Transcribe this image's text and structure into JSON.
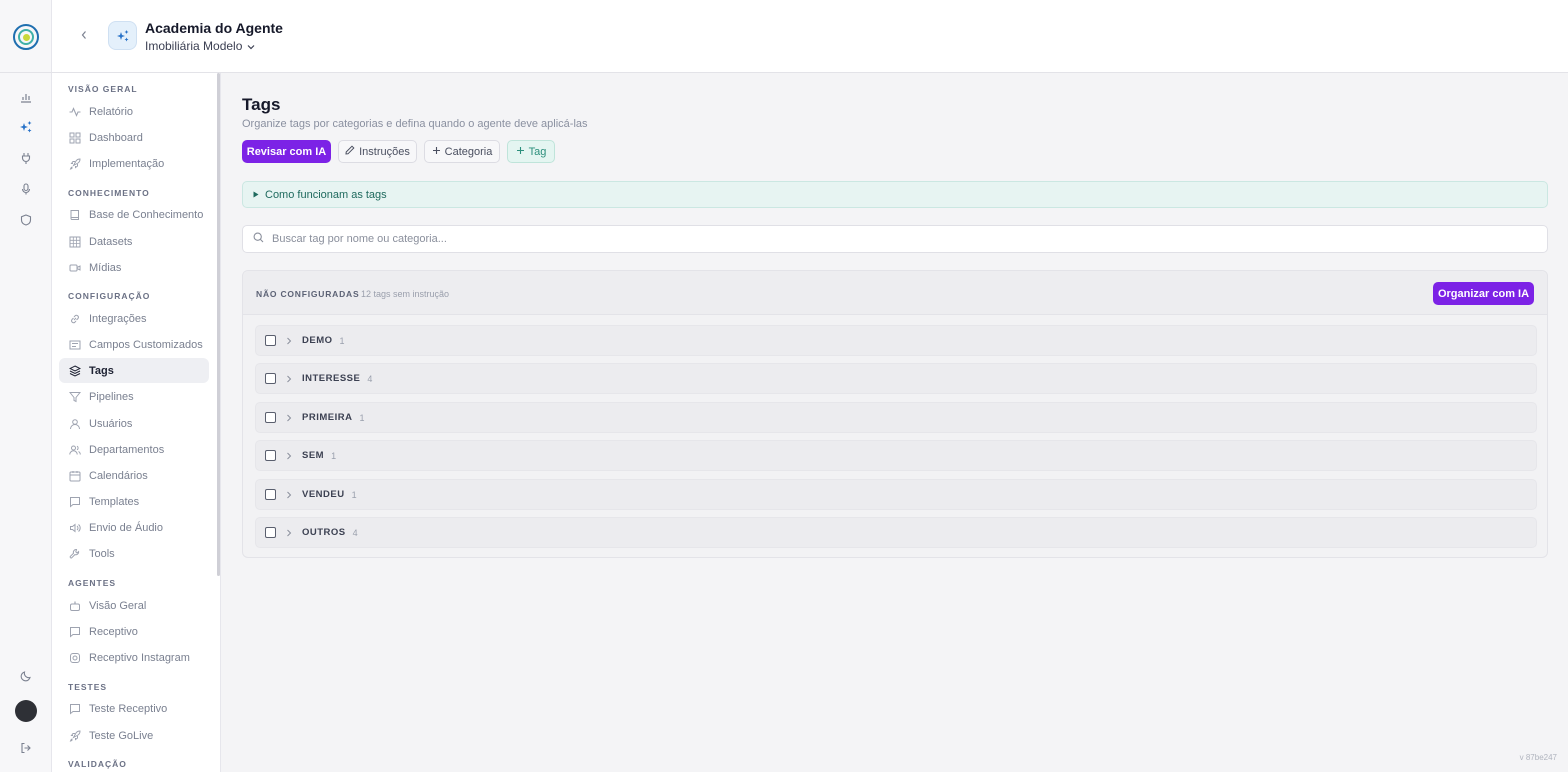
{
  "header": {
    "agent_name": "Academia do Agente",
    "organization": "Imobiliária Modelo"
  },
  "sidebar": {
    "sections": [
      {
        "title": "VISÃO GERAL",
        "items": [
          "Relatório",
          "Dashboard",
          "Implementação"
        ]
      },
      {
        "title": "CONHECIMENTO",
        "items": [
          "Base de Conhecimento",
          "Datasets",
          "Mídias"
        ]
      },
      {
        "title": "CONFIGURAÇÃO",
        "items": [
          "Integrações",
          "Campos Customizados",
          "Tags",
          "Pipelines",
          "Usuários",
          "Departamentos",
          "Calendários",
          "Templates",
          "Envio de Áudio",
          "Tools"
        ]
      },
      {
        "title": "AGENTES",
        "items": [
          "Visão Geral",
          "Receptivo",
          "Receptivo Instagram"
        ]
      },
      {
        "title": "TESTES",
        "items": [
          "Teste Receptivo",
          "Teste GoLive"
        ]
      },
      {
        "title": "VALIDAÇÃO",
        "items": []
      }
    ],
    "active_item": "Tags"
  },
  "page": {
    "title": "Tags",
    "subtitle": "Organize tags por categorias e defina quando o agente deve aplicá-las",
    "buttons": {
      "review": "Revisar com IA",
      "instructions": "Instruções",
      "category": "Categoria",
      "tag": "Tag"
    },
    "info_toggle": "Como funcionam as tags",
    "search_placeholder": "Buscar tag por nome ou categoria..."
  },
  "panel": {
    "title": "NÃO CONFIGURADAS",
    "count_text": "12 tags sem instrução",
    "organize_button": "Organizar com IA",
    "categories": [
      {
        "name": "DEMO",
        "count": "1"
      },
      {
        "name": "INTERESSE",
        "count": "4"
      },
      {
        "name": "PRIMEIRA",
        "count": "1"
      },
      {
        "name": "SEM",
        "count": "1"
      },
      {
        "name": "VENDEU",
        "count": "1"
      },
      {
        "name": "OUTROS",
        "count": "4"
      }
    ]
  },
  "version": "v 87be247",
  "colors": {
    "primary": "#7c22e6",
    "tag_accent": "#2c8f7c",
    "info_bg": "#e7f4f2"
  }
}
